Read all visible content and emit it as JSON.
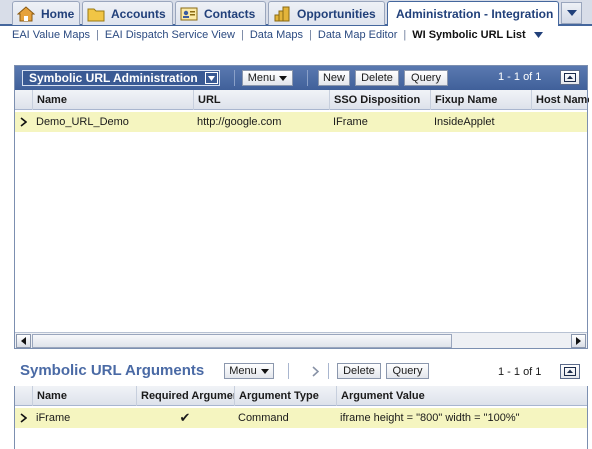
{
  "tabs": [
    {
      "label": "Home",
      "icon": "home-icon"
    },
    {
      "label": "Accounts",
      "icon": "folder-icon"
    },
    {
      "label": "Contacts",
      "icon": "contact-card-icon"
    },
    {
      "label": "Opportunities",
      "icon": "coins-icon"
    },
    {
      "label": "Administration - Integration",
      "active": true
    }
  ],
  "subnav": {
    "links": [
      "EAI Value Maps",
      "EAI Dispatch Service View",
      "Data Maps",
      "Data Map Editor"
    ],
    "current": "WI Symbolic URL List"
  },
  "applet_admin": {
    "title": "Symbolic URL Administration",
    "buttons": {
      "menu": "Menu",
      "new": "New",
      "delete": "Delete",
      "query": "Query"
    },
    "record_count": "1 - 1 of 1",
    "columns": [
      "Name",
      "URL",
      "SSO Disposition",
      "Fixup Name",
      "Host Name"
    ],
    "rows": [
      {
        "name": "Demo_URL_Demo",
        "url": "http://google.com",
        "sso": "IFrame",
        "fixup": "InsideApplet",
        "host": ""
      }
    ]
  },
  "applet_args": {
    "title": "Symbolic URL Arguments",
    "buttons": {
      "menu": "Menu",
      "delete": "Delete",
      "query": "Query"
    },
    "record_count": "1 - 1 of 1",
    "columns": [
      "Name",
      "Required Argument",
      "Argument Type",
      "Argument Value"
    ],
    "rows": [
      {
        "name": "iFrame",
        "required": "✔",
        "type": "Command",
        "value": "iframe height = \"800\" width = \"100%\""
      }
    ]
  },
  "colors": {
    "accent": "#45679d",
    "header": "#4a6aa5",
    "selected_row": "#f5f5c0"
  }
}
